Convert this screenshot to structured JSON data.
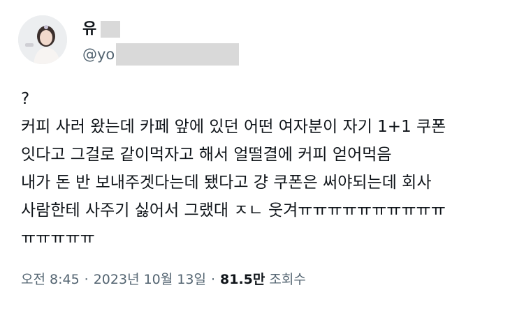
{
  "author": {
    "name": "유",
    "handle": "@yo"
  },
  "tweet": {
    "lines": [
      "?",
      "커피 사러 왔는데 카페 앞에 있던 어떤 여자분이 자기 1+1 쿠폰",
      "잇다고 그걸로 같이먹자고 해서 얼떨결에 커피 얻어먹음",
      "내가 돈 반 보내주겟다는데 됐다고 걍 쿠폰은 써야되는데 회사",
      "사람한테 사주기 싫어서 그랬대 ㅈㄴ 웃겨ㅠㅠㅠㅠㅠㅠㅠㅠㅠㅠ",
      "ㅠㅠㅠㅠㅠ"
    ]
  },
  "meta": {
    "time": "오전 8:45",
    "separator": "·",
    "date": "2023년 10월 13일",
    "views_count": "81.5만",
    "views_label": "조회수"
  }
}
